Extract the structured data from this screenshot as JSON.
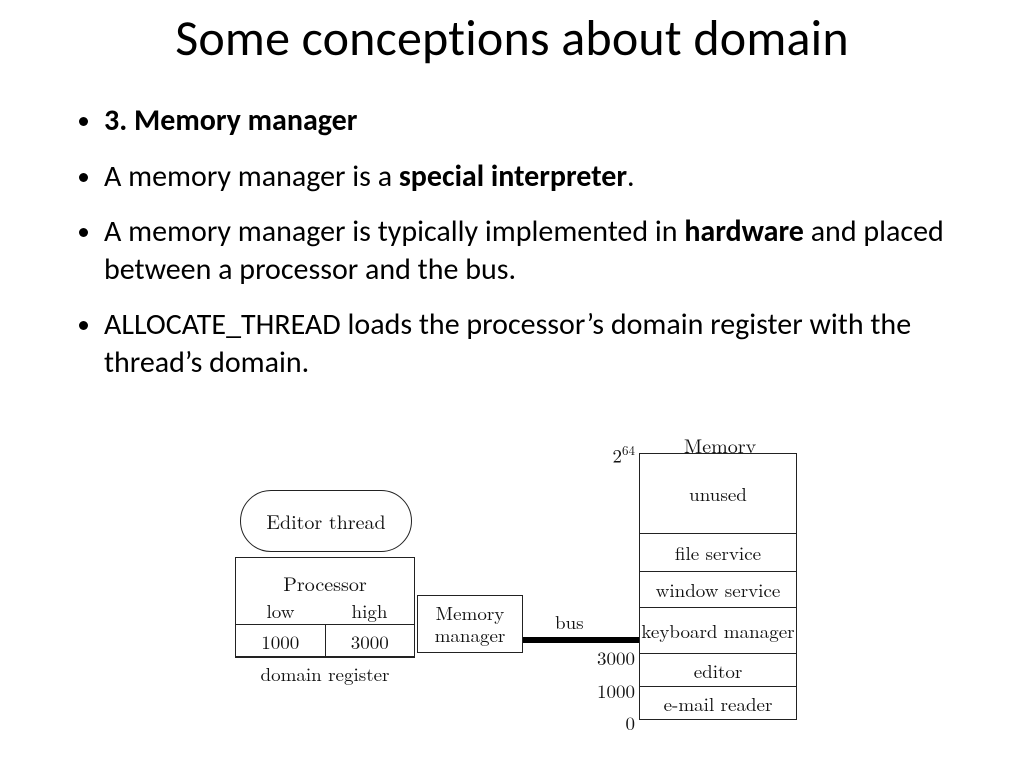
{
  "title": "Some conceptions about domain",
  "bullets": {
    "b1": "3. Memory manager",
    "b2_a": "A memory manager is a ",
    "b2_b": "special interpreter",
    "b2_c": ".",
    "b3_a": "A memory manager is typically implemented in ",
    "b3_b": "hardware",
    "b3_c": " and placed between a processor and the bus.",
    "b4": "ALLOCATE_THREAD loads the processor’s domain register with the thread’s domain."
  },
  "diagram": {
    "thread": "Editor thread",
    "processor": {
      "title": "Processor",
      "low_label": "low",
      "high_label": "high",
      "low": "1000",
      "high": "3000",
      "caption": "domain register"
    },
    "memmgr": "Memory manager",
    "bus": "bus",
    "memory": {
      "title": "Memory",
      "top_base": "2",
      "top_exp": "64",
      "rows": {
        "r0": "unused",
        "r1": "file service",
        "r2": "window service",
        "r3": "keyboard manager",
        "r4": "editor",
        "r5": "e-mail reader"
      },
      "addr_3000": "3000",
      "addr_1000": "1000",
      "addr_0": "0"
    }
  }
}
